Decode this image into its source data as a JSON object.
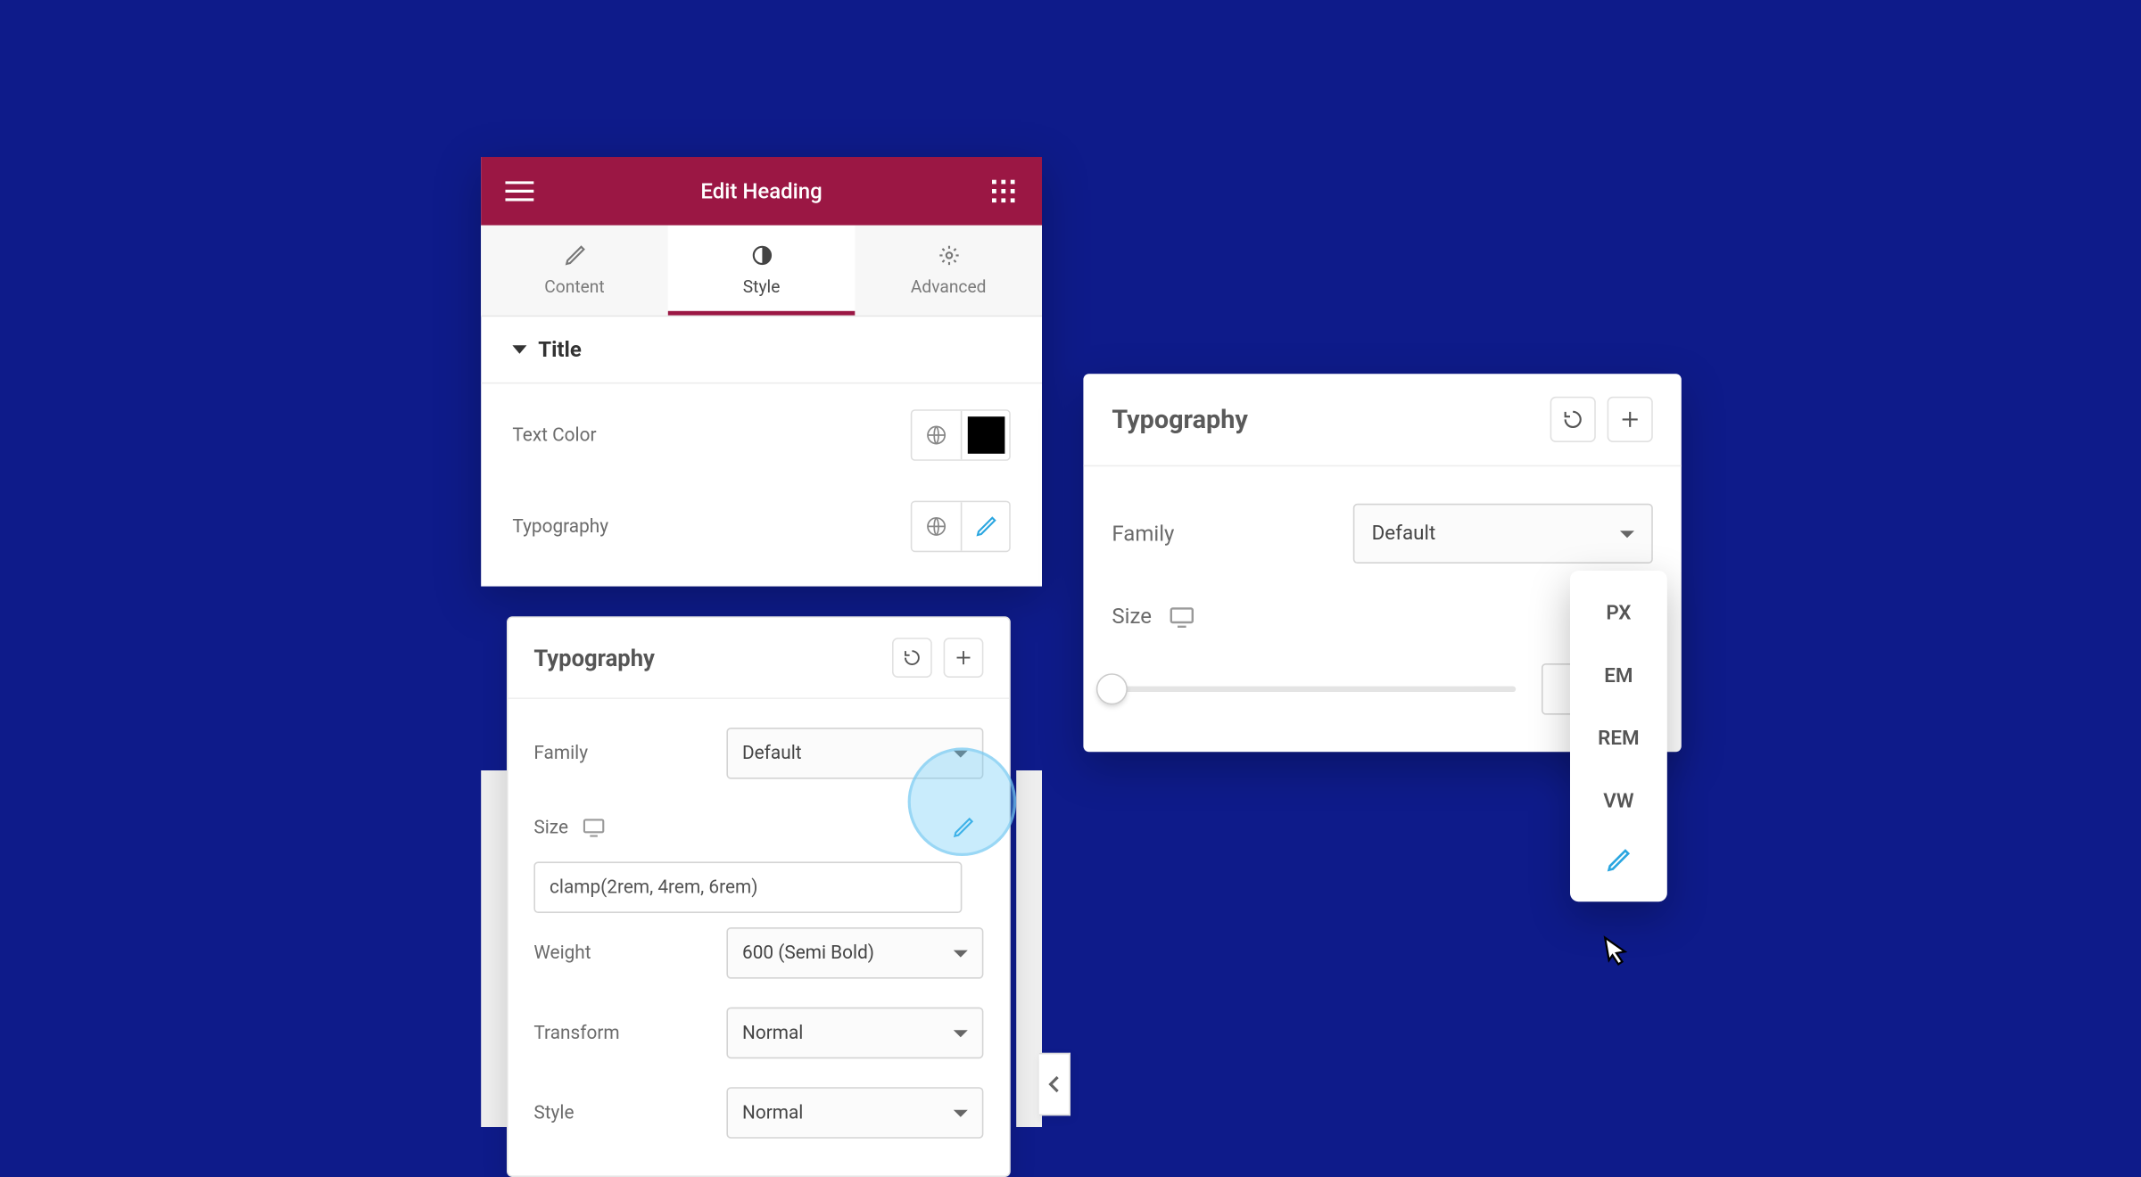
{
  "header": {
    "title": "Edit Heading"
  },
  "tabs": {
    "content": "Content",
    "style": "Style",
    "advanced": "Advanced"
  },
  "section": {
    "title": "Title"
  },
  "rows": {
    "text_color": "Text Color",
    "typography": "Typography"
  },
  "popover": {
    "title": "Typography",
    "family_label": "Family",
    "family_value": "Default",
    "size_label": "Size",
    "size_value": "clamp(2rem, 4rem, 6rem)",
    "weight_label": "Weight",
    "weight_value": "600 (Semi Bold)",
    "transform_label": "Transform",
    "transform_value": "Normal",
    "style_label": "Style",
    "style_value": "Normal"
  },
  "panel2": {
    "title": "Typography",
    "family_label": "Family",
    "family_value": "Default",
    "size_label": "Size"
  },
  "units": {
    "px": "PX",
    "em": "EM",
    "rem": "REM",
    "vw": "VW"
  }
}
